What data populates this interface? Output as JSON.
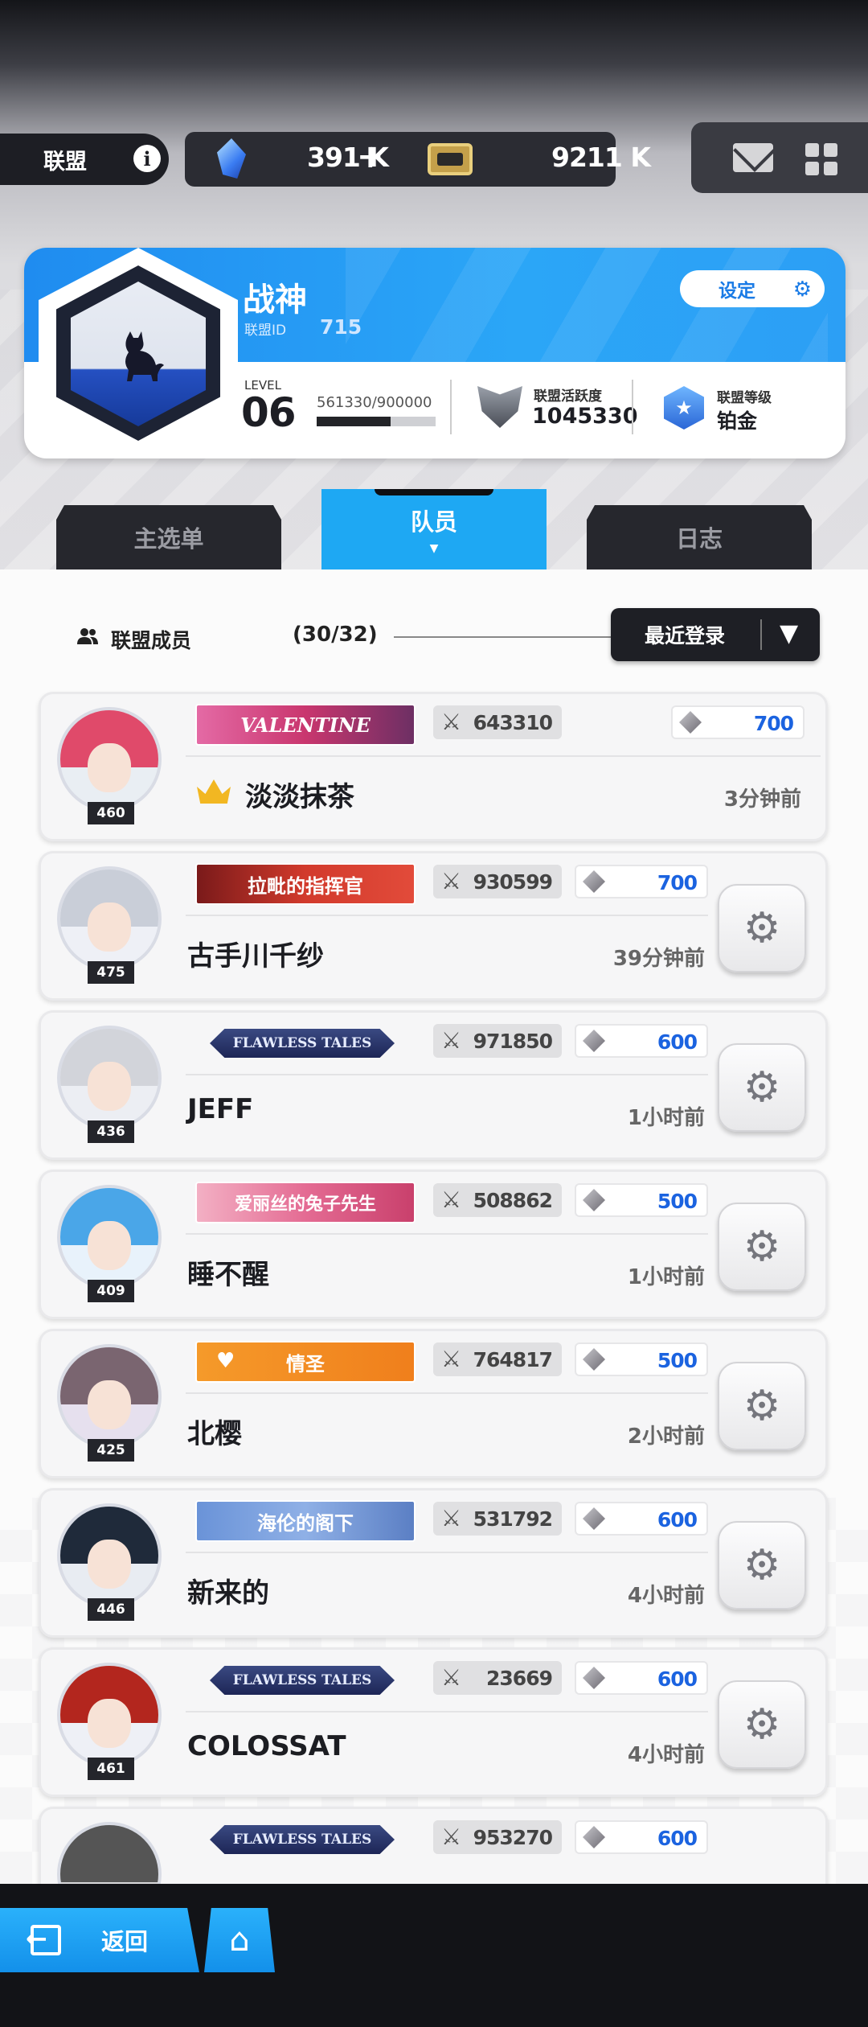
{
  "header": {
    "alliance_label": "联盟",
    "info_icon": "info-icon",
    "crystal_value": "391 K",
    "plus_icon": "plus-icon",
    "ticket_value": "9211 K",
    "mail_icon": "mail-icon",
    "menu_icon": "grid-icon"
  },
  "alliance": {
    "name": "战神",
    "id_label": "联盟ID",
    "id_value": "715",
    "settings_label": "设定",
    "level_label": "LEVEL",
    "level_value": "06",
    "exp_text": "561330/900000",
    "exp_fraction": 0.6237,
    "activity_label": "联盟活跃度",
    "activity_value": "1045330",
    "rank_label": "联盟等级",
    "rank_value": "铂金"
  },
  "tabs": [
    {
      "label": "主选单"
    },
    {
      "label": "队员"
    },
    {
      "label": "日志"
    }
  ],
  "members_section": {
    "label": "联盟成员",
    "count": "(30/32)",
    "sort_label": "最近登录"
  },
  "members": [
    {
      "banner": "VALENTINE",
      "power": "643310",
      "contribution": "700",
      "name": "淡淡抹茶",
      "last_login": "3分钟前",
      "level": "460"
    },
    {
      "banner": "拉毗的指挥官",
      "power": "930599",
      "contribution": "700",
      "name": "古手川千纱",
      "last_login": "39分钟前",
      "level": "475"
    },
    {
      "banner": "FLAWLESS TALES",
      "power": "971850",
      "contribution": "600",
      "name": "JEFF",
      "last_login": "1小时前",
      "level": "436"
    },
    {
      "banner": "爱丽丝的兔子先生",
      "power": "508862",
      "contribution": "500",
      "name": "睡不醒",
      "last_login": "1小时前",
      "level": "409"
    },
    {
      "banner": "情圣",
      "power": "764817",
      "contribution": "500",
      "name": "北樱",
      "last_login": "2小时前",
      "level": "425"
    },
    {
      "banner": "海伦的阁下",
      "power": "531792",
      "contribution": "600",
      "name": "新来的",
      "last_login": "4小时前",
      "level": "446"
    },
    {
      "banner": "FLAWLESS TALES",
      "power": "23669",
      "contribution": "600",
      "name": "COLOSSAT",
      "last_login": "4小时前",
      "level": "461"
    },
    {
      "banner": "FLAWLESS TALES",
      "power": "953270",
      "contribution": "600"
    }
  ],
  "footer": {
    "back_label": "返回",
    "home_icon": "home-icon"
  }
}
